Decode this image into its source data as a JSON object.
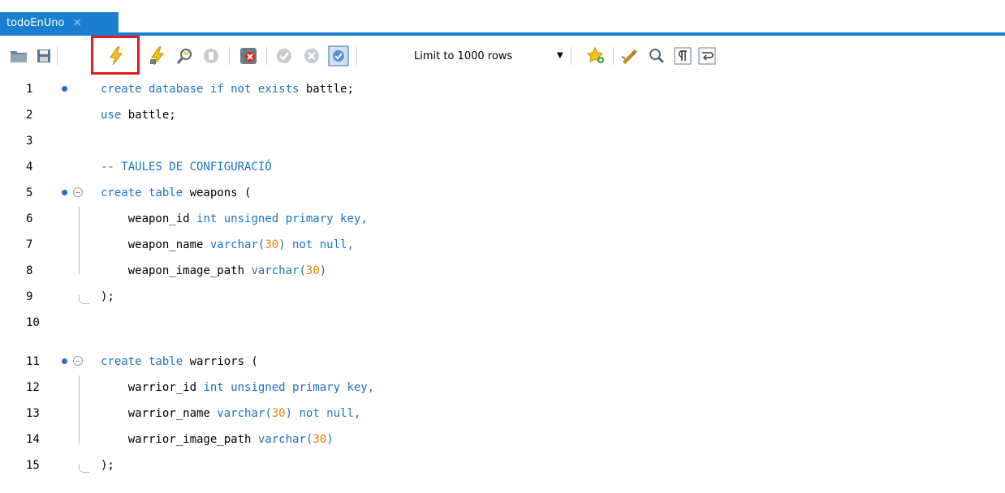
{
  "tab": {
    "label": "todoEnUno",
    "close": "×"
  },
  "toolbar": {
    "limit_label": "Limit to 1000 rows",
    "icons": [
      "open-folder-icon",
      "save-icon",
      "execute-icon",
      "execute-current-icon",
      "explain-icon",
      "stop-icon",
      "toggle-error-icon",
      "commit-icon",
      "rollback-icon",
      "autocommit-icon",
      "add-snippet-icon",
      "beautify-icon",
      "find-icon",
      "invisible-chars-icon",
      "wrap-icon"
    ]
  },
  "editor": {
    "lines": [
      {
        "n": "1",
        "t1": "create database if not exists ",
        "t2": "battle;"
      },
      {
        "n": "2",
        "t1": "use ",
        "t2": "battle;"
      },
      {
        "n": "3"
      },
      {
        "n": "4",
        "t1": "-- TAULES DE CONFIGURACIÓ"
      },
      {
        "n": "5",
        "t1": "create table ",
        "t2": "weapons ("
      },
      {
        "n": "6",
        "t1": "    weapon_id ",
        "t2": "int unsigned primary key",
        "t3": ","
      },
      {
        "n": "7",
        "t1": "    weapon_name ",
        "t2": "varchar",
        "t3": "(",
        "t4": "30",
        "t5": ") ",
        "t6": "not null",
        "t7": ","
      },
      {
        "n": "8",
        "t1": "    weapon_image_path ",
        "t2": "varchar",
        "t3": "(",
        "t4": "30",
        "t5": ")"
      },
      {
        "n": "9",
        "t1": ");"
      },
      {
        "n": "10"
      },
      {
        "n": "11",
        "t1": "create table ",
        "t2": "warriors ("
      },
      {
        "n": "12",
        "t1": "    warrior_id ",
        "t2": "int unsigned primary key",
        "t3": ","
      },
      {
        "n": "13",
        "t1": "    warrior_name ",
        "t2": "varchar",
        "t3": "(",
        "t4": "30",
        "t5": ") ",
        "t6": "not null",
        "t7": ","
      },
      {
        "n": "14",
        "t1": "    warrior_image_path ",
        "t2": "varchar",
        "t3": "(",
        "t4": "30",
        "t5": ")"
      },
      {
        "n": "15",
        "t1": ");"
      }
    ]
  }
}
